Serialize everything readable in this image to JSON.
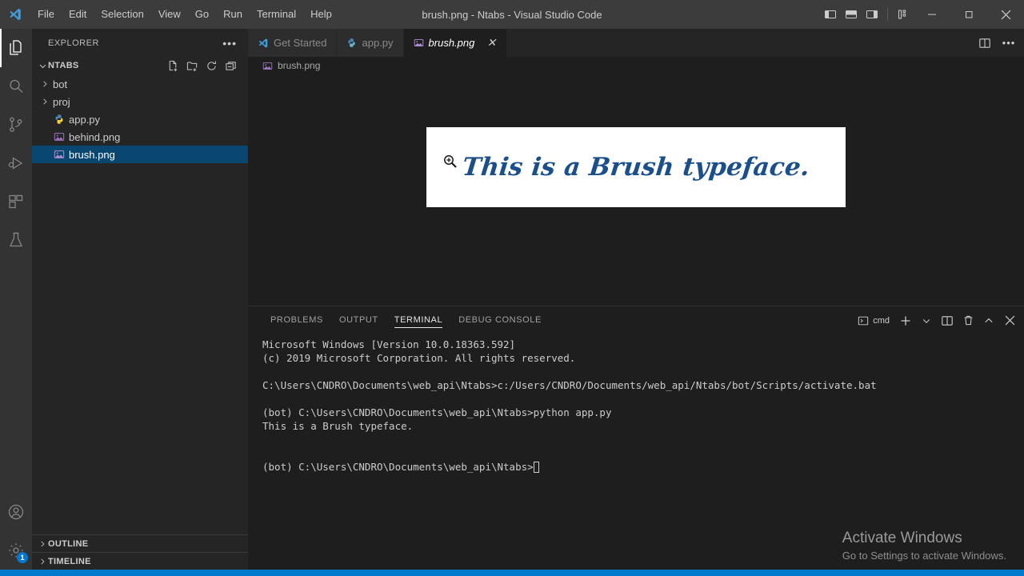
{
  "window": {
    "title": "brush.png - Ntabs - Visual Studio Code",
    "logo_name": "vscode-logo-icon",
    "menu": [
      "File",
      "Edit",
      "Selection",
      "View",
      "Go",
      "Run",
      "Terminal",
      "Help"
    ],
    "layout_buttons": [
      {
        "name": "toggle-primary-sidebar-icon",
        "label": ""
      },
      {
        "name": "toggle-panel-icon",
        "label": ""
      },
      {
        "name": "toggle-secondary-sidebar-icon",
        "label": ""
      },
      {
        "name": "customize-layout-icon",
        "label": ""
      }
    ],
    "controls": [
      {
        "name": "minimize-button",
        "glyph": "─"
      },
      {
        "name": "maximize-button",
        "glyph": "❑"
      },
      {
        "name": "close-button",
        "glyph": "✕"
      }
    ]
  },
  "activity_bar": {
    "items": [
      {
        "name": "activitybar-explorer",
        "icon": "files-icon",
        "active": true
      },
      {
        "name": "activitybar-search",
        "icon": "search-icon",
        "active": false
      },
      {
        "name": "activitybar-source-control",
        "icon": "source-control-icon",
        "active": false
      },
      {
        "name": "activitybar-run-debug",
        "icon": "run-and-debug-icon",
        "active": false
      },
      {
        "name": "activitybar-extensions",
        "icon": "extensions-icon",
        "active": false
      },
      {
        "name": "activitybar-testing",
        "icon": "beaker-icon",
        "active": false
      }
    ],
    "bottom": [
      {
        "name": "activitybar-accounts",
        "icon": "account-icon",
        "badge": ""
      },
      {
        "name": "activitybar-settings",
        "icon": "gear-icon",
        "badge": "1"
      }
    ]
  },
  "sidebar": {
    "header": "EXPLORER",
    "more_actions": "•••",
    "folder": {
      "name": "NTABS",
      "expanded": true,
      "actions": [
        {
          "name": "new-file-icon"
        },
        {
          "name": "new-folder-icon"
        },
        {
          "name": "refresh-explorer-icon"
        },
        {
          "name": "collapse-folders-icon"
        }
      ]
    },
    "tree": [
      {
        "label": "bot",
        "type": "folder",
        "icon": "folder-icon",
        "expanded": false,
        "selected": false
      },
      {
        "label": "proj",
        "type": "folder",
        "icon": "folder-icon",
        "expanded": false,
        "selected": false
      },
      {
        "label": "app.py",
        "type": "file",
        "icon": "python-file-icon",
        "selected": false
      },
      {
        "label": "behind.png",
        "type": "file",
        "icon": "image-file-icon",
        "selected": false
      },
      {
        "label": "brush.png",
        "type": "file",
        "icon": "image-file-icon",
        "selected": true
      }
    ],
    "sections": [
      {
        "label": "OUTLINE",
        "expanded": false
      },
      {
        "label": "TIMELINE",
        "expanded": false
      }
    ]
  },
  "editor": {
    "tabs": [
      {
        "label": "Get Started",
        "icon": "vscode-logo-icon",
        "active": false,
        "closable": false
      },
      {
        "label": "app.py",
        "icon": "python-file-icon",
        "active": false,
        "closable": false
      },
      {
        "label": "brush.png",
        "icon": "image-file-icon",
        "active": true,
        "closable": true,
        "close_glyph": "✕"
      }
    ],
    "actions": [
      {
        "name": "split-editor-icon"
      },
      {
        "name": "editor-more-actions-icon",
        "glyph": "•••"
      }
    ],
    "breadcrumb": {
      "label": "brush.png",
      "icon": "image-file-icon"
    },
    "preview": {
      "image_text": "This is a Brush typeface.",
      "text_color": "#1b4f8c",
      "background": "#ffffff",
      "cursor_icon": "zoom-in-cursor-icon"
    }
  },
  "panel": {
    "tabs": [
      {
        "label": "PROBLEMS",
        "active": false
      },
      {
        "label": "OUTPUT",
        "active": false
      },
      {
        "label": "TERMINAL",
        "active": true
      },
      {
        "label": "DEBUG CONSOLE",
        "active": false
      }
    ],
    "terminal_selector": {
      "label": "cmd",
      "icon": "terminal-cmd-icon",
      "chevron": "⌄"
    },
    "actions": [
      {
        "name": "new-terminal-icon",
        "glyph": "+"
      },
      {
        "name": "terminal-dropdown-icon",
        "glyph": "⌄"
      },
      {
        "name": "split-terminal-icon",
        "glyph": ""
      },
      {
        "name": "kill-terminal-icon",
        "glyph": ""
      },
      {
        "name": "maximize-panel-icon",
        "glyph": "⌃"
      },
      {
        "name": "close-panel-icon",
        "glyph": "✕"
      }
    ],
    "terminal_lines": [
      "Microsoft Windows [Version 10.0.18363.592]",
      "(c) 2019 Microsoft Corporation. All rights reserved.",
      "",
      "C:\\Users\\CNDRO\\Documents\\web_api\\Ntabs>c:/Users/CNDRO/Documents/web_api/Ntabs/bot/Scripts/activate.bat",
      "",
      "(bot) C:\\Users\\CNDRO\\Documents\\web_api\\Ntabs>python app.py",
      "This is a Brush typeface.",
      "",
      ""
    ],
    "terminal_prompt": "(bot) C:\\Users\\CNDRO\\Documents\\web_api\\Ntabs>"
  },
  "watermark": {
    "title": "Activate Windows",
    "subtitle": "Go to Settings to activate Windows."
  },
  "colors": {
    "accent": "#007acc",
    "selection": "#094771",
    "titlebar": "#3c3c3c",
    "sidebar": "#252526",
    "editor": "#1e1e1e",
    "activitybar": "#333333"
  }
}
